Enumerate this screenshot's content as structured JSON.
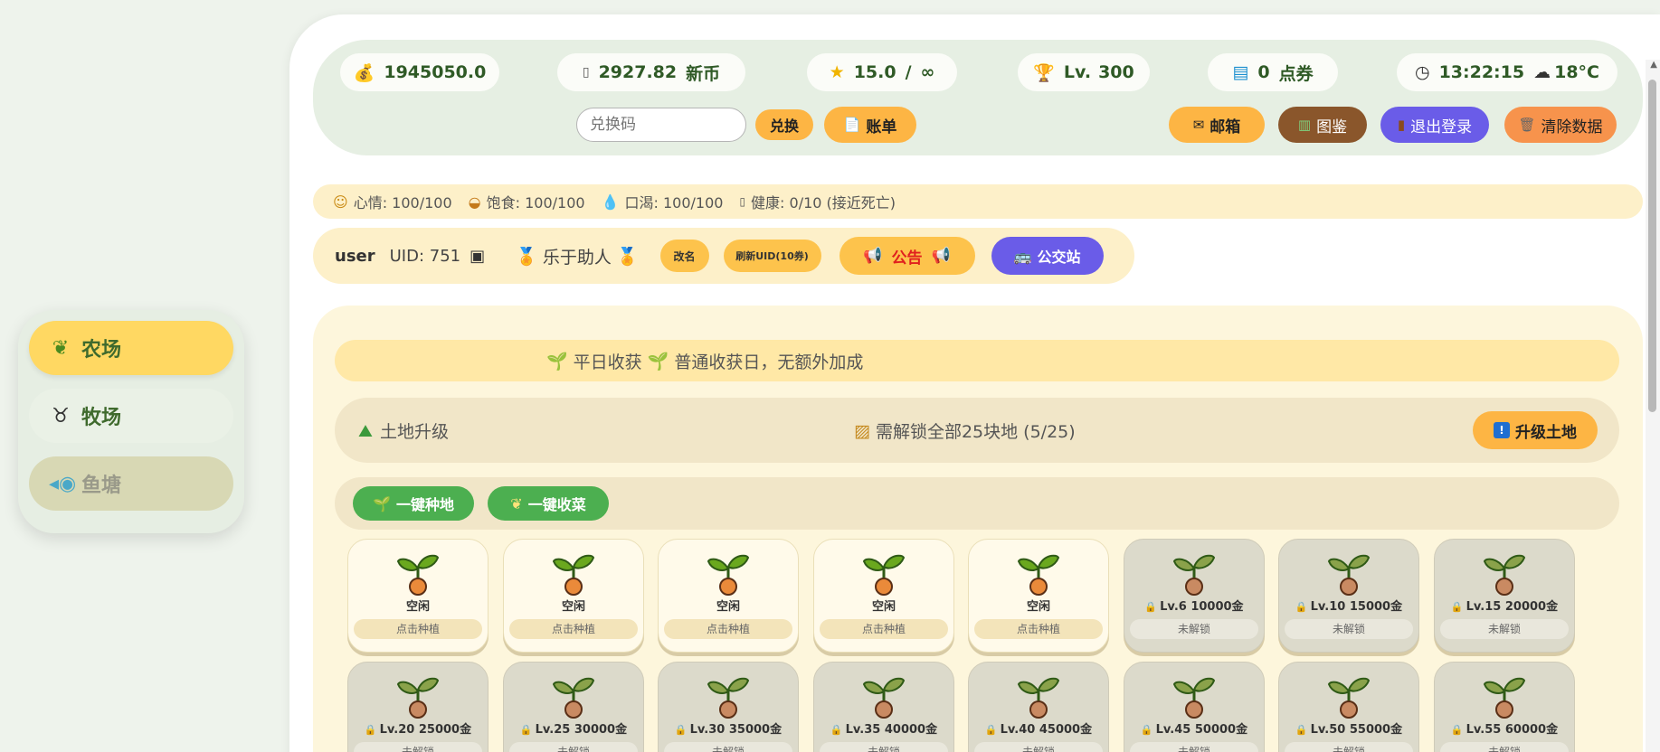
{
  "nav": {
    "items": [
      {
        "label": "农场",
        "icon": "wheat-icon",
        "state": "active"
      },
      {
        "label": "牧场",
        "icon": "cow-icon",
        "state": "normal"
      },
      {
        "label": "鱼塘",
        "icon": "fish-icon",
        "state": "locked"
      }
    ]
  },
  "header": {
    "gold": "1945050.0",
    "coin_value": "2927.82",
    "coin_unit": "新币",
    "star_value": "15.0",
    "star_sep": "/",
    "star_max": "∞",
    "level_prefix": "Lv.",
    "level_value": "300",
    "ticket_value": "0",
    "ticket_unit": "点券",
    "time": "13:22:15",
    "temperature": "18°C",
    "redeem_placeholder": "兑换码",
    "redeem_button": "兑换",
    "bill_button": "账单",
    "mailbox_button": "邮箱",
    "catalog_button": "图鉴",
    "logout_button": "退出登录",
    "clear_button": "清除数据"
  },
  "status": {
    "mood": "心情: 100/100",
    "satiety": "饱食: 100/100",
    "thirst": "口渴: 100/100",
    "health": "健康: 0/10 (接近死亡)"
  },
  "user": {
    "name": "user",
    "uid": "UID: 751",
    "title": "乐于助人",
    "rename_button": "改名",
    "refresh_uid_button": "刷新UID(10券)",
    "announce_button": "公告",
    "bus_button": "公交站"
  },
  "farm": {
    "harvest_type": "平日收获",
    "harvest_desc": "普通收获日，无额外加成",
    "land_title": "土地升级",
    "land_need": "需解锁全部25块地 (5/25)",
    "upgrade_button": "升级土地",
    "plant_all_button": "一键种地",
    "harvest_all_button": "一键收菜",
    "plots": [
      {
        "title": "空闲",
        "status": "点击种植",
        "locked": false
      },
      {
        "title": "空闲",
        "status": "点击种植",
        "locked": false
      },
      {
        "title": "空闲",
        "status": "点击种植",
        "locked": false
      },
      {
        "title": "空闲",
        "status": "点击种植",
        "locked": false
      },
      {
        "title": "空闲",
        "status": "点击种植",
        "locked": false
      },
      {
        "title": "Lv.6 10000金",
        "status": "未解锁",
        "locked": true
      },
      {
        "title": "Lv.10 15000金",
        "status": "未解锁",
        "locked": true
      },
      {
        "title": "Lv.15 20000金",
        "status": "未解锁",
        "locked": true
      },
      {
        "title": "Lv.20 25000金",
        "status": "未解锁",
        "locked": true
      },
      {
        "title": "Lv.25 30000金",
        "status": "未解锁",
        "locked": true
      },
      {
        "title": "Lv.30 35000金",
        "status": "未解锁",
        "locked": true
      },
      {
        "title": "Lv.35 40000金",
        "status": "未解锁",
        "locked": true
      },
      {
        "title": "Lv.40 45000金",
        "status": "未解锁",
        "locked": true
      },
      {
        "title": "Lv.45 50000金",
        "status": "未解锁",
        "locked": true
      },
      {
        "title": "Lv.50 55000金",
        "status": "未解锁",
        "locked": true
      },
      {
        "title": "Lv.55 60000金",
        "status": "未解锁",
        "locked": true
      }
    ]
  },
  "colors": {
    "accent_yellow": "#ffd862",
    "green_button": "#4caf50",
    "orange_button": "#fdb544",
    "purple_button": "#6a5ce8"
  }
}
